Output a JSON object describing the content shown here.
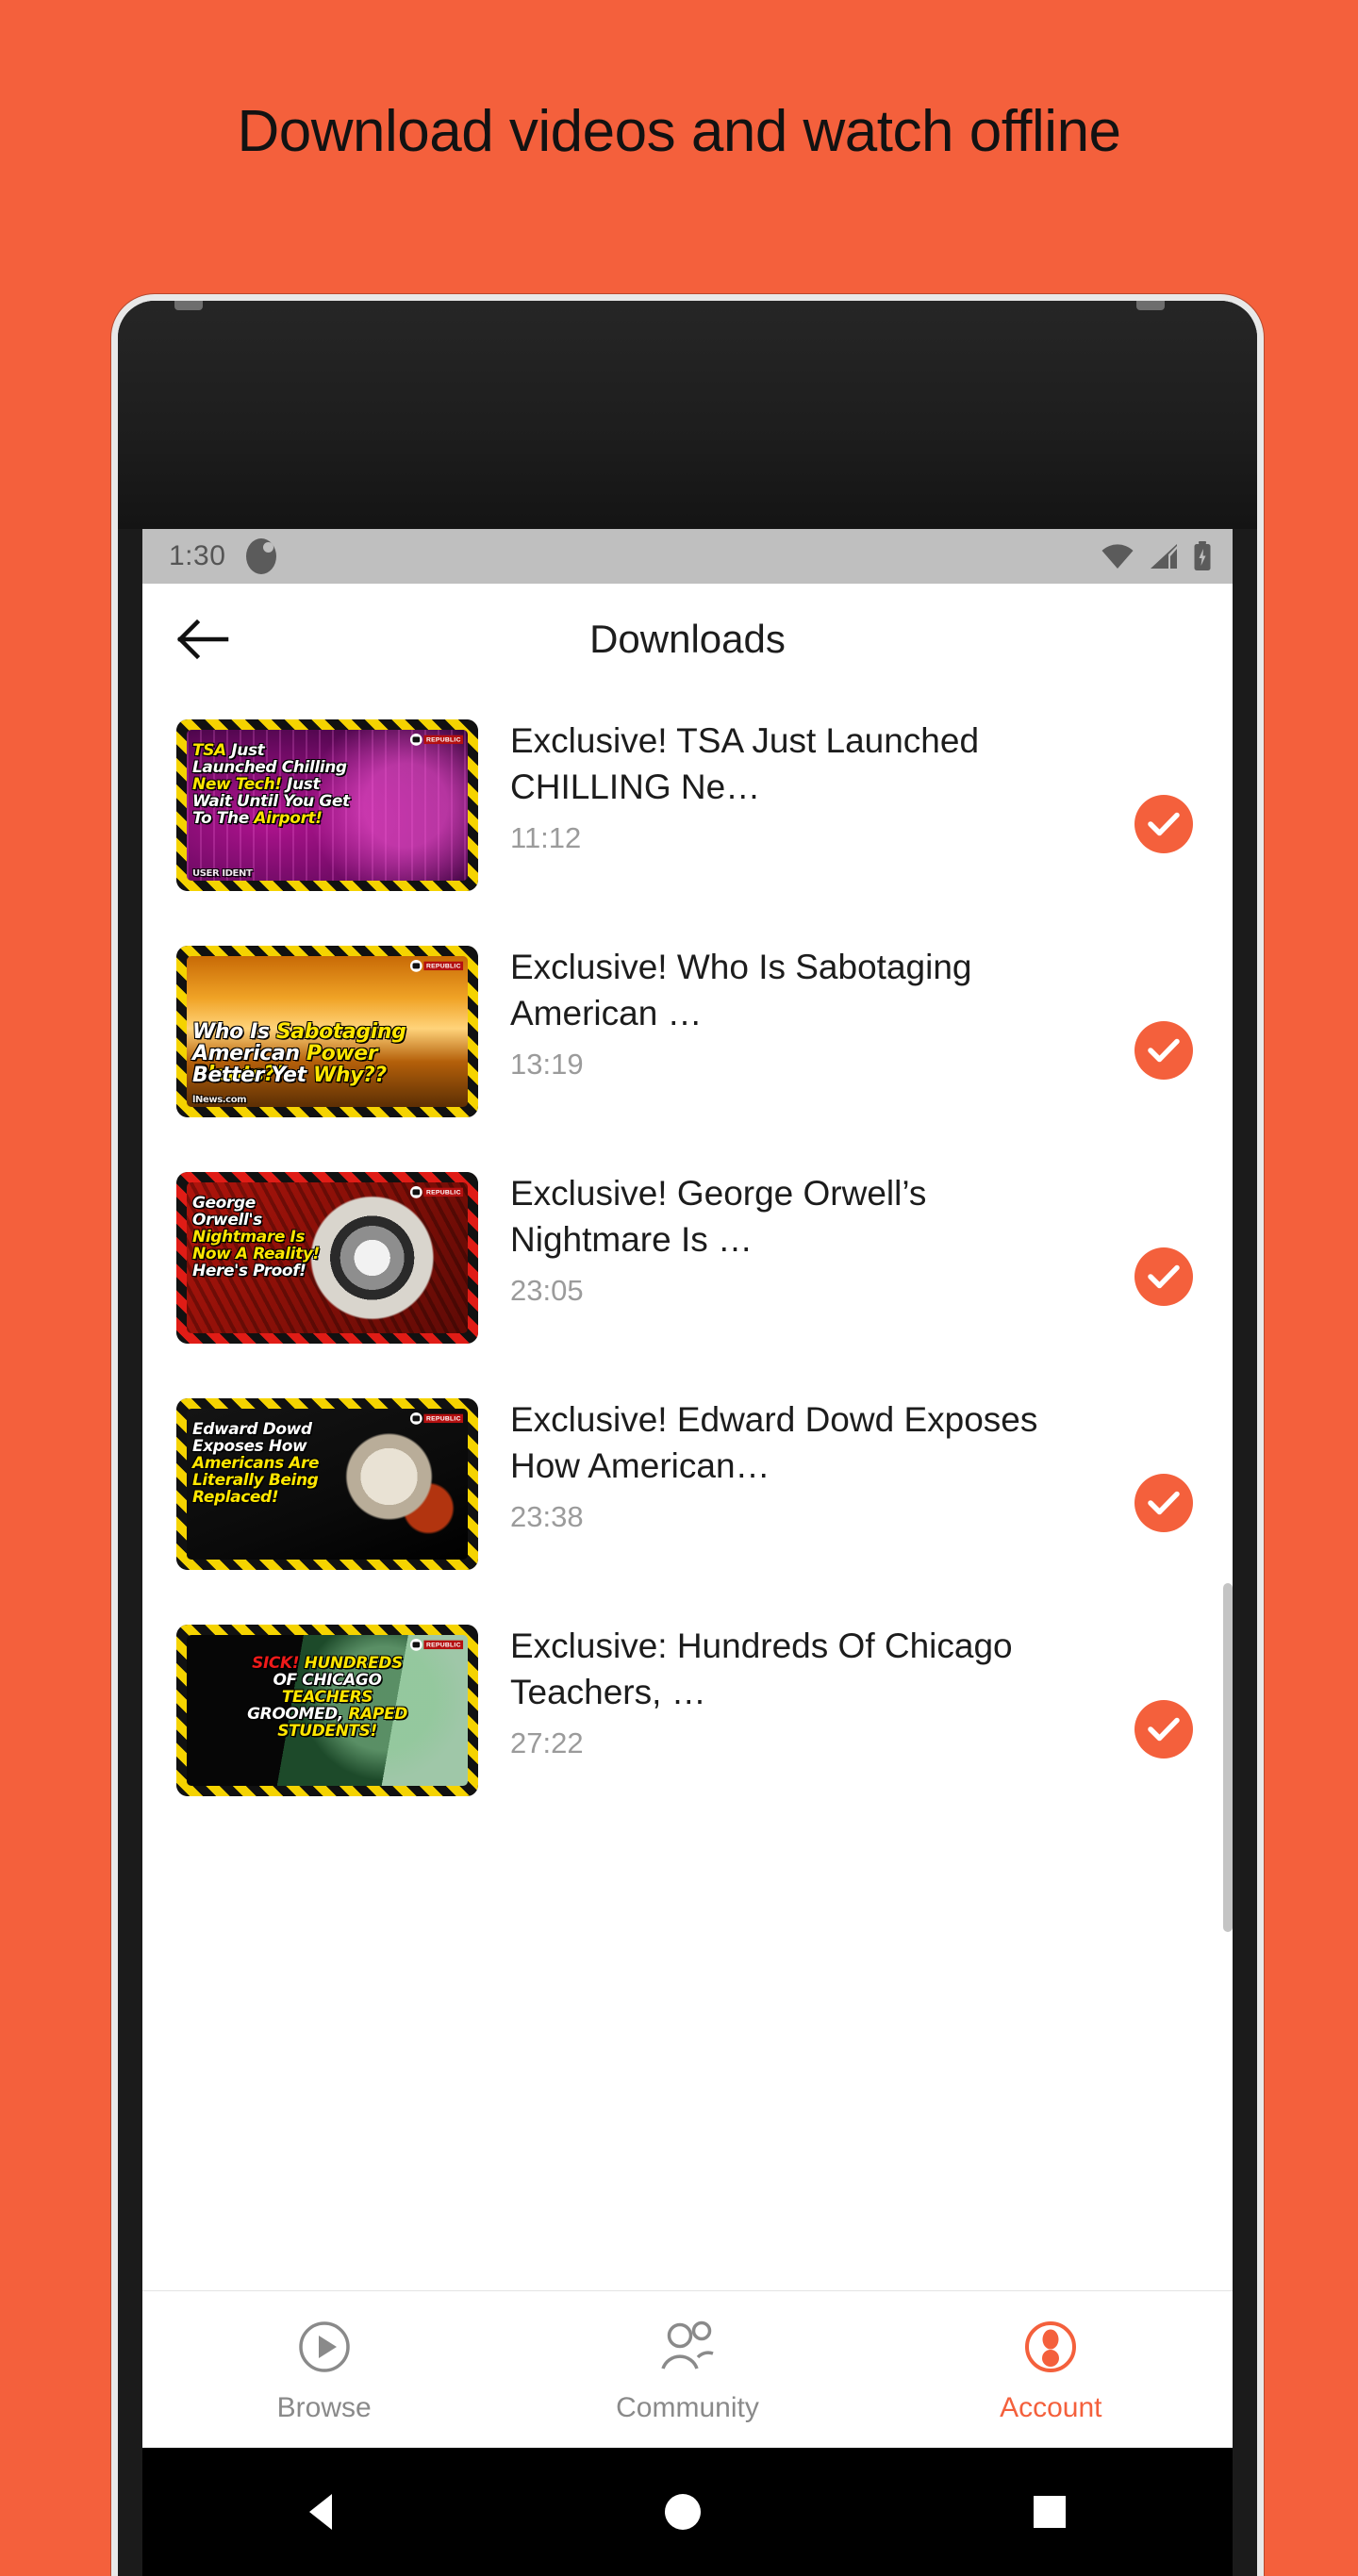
{
  "page": {
    "headline": "Download videos and watch offline",
    "background_color": "#F4603C",
    "accent_color": "#F4603C"
  },
  "statusbar": {
    "time": "1:30",
    "notification_icon": "app-notification-icon",
    "icons": [
      "wifi-icon",
      "cell-signal-icon",
      "battery-charging-icon"
    ]
  },
  "appbar": {
    "back_icon": "back-arrow-icon",
    "title": "Downloads"
  },
  "downloads": [
    {
      "title": "Exclusive! TSA Just Launched CHILLING Ne…",
      "duration": "11:12",
      "checked": true,
      "thumb": {
        "border": "yellow-hazard",
        "bg": "magenta-face-scan",
        "watermark": "REPUBLIC",
        "footer": "USER IDENT",
        "lines": [
          [
            {
              "t": "TSA ",
              "c": "y"
            },
            {
              "t": "Just",
              "c": "w"
            }
          ],
          [
            {
              "t": "Launched Chilling",
              "c": "w"
            }
          ],
          [
            {
              "t": "New Tech!",
              "c": "y"
            },
            {
              "t": " Just",
              "c": "w"
            }
          ],
          [
            {
              "t": "Wait Until You Get",
              "c": "w"
            }
          ],
          [
            {
              "t": "To The ",
              "c": "w"
            },
            {
              "t": "Airport!",
              "c": "y"
            }
          ]
        ]
      }
    },
    {
      "title": "Exclusive! Who Is Sabotaging American …",
      "duration": "13:19",
      "checked": true,
      "thumb": {
        "border": "yellow-hazard",
        "bg": "orange-power-plant",
        "watermark": "REPUBLIC",
        "footer": "lNews.com",
        "lines": [
          [
            {
              "t": "Who Is ",
              "c": "w"
            },
            {
              "t": "Sabotaging",
              "c": "y"
            }
          ],
          [
            {
              "t": "American ",
              "c": "w"
            },
            {
              "t": "Power Plants?!",
              "c": "y"
            }
          ],
          [
            {
              "t": "Better Yet ",
              "c": "w"
            },
            {
              "t": "Why??",
              "c": "y"
            }
          ]
        ]
      }
    },
    {
      "title": "Exclusive! George Orwell’s Nightmare Is …",
      "duration": "23:05",
      "checked": true,
      "thumb": {
        "border": "red-hazard",
        "bg": "red-surveillance-eye",
        "watermark": "REPUBLIC",
        "footer": "",
        "lines": [
          [
            {
              "t": "George",
              "c": "w"
            }
          ],
          [
            {
              "t": "Orwell's",
              "c": "w"
            }
          ],
          [
            {
              "t": "Nightmare Is",
              "c": "y"
            }
          ],
          [
            {
              "t": "Now A Reality!",
              "c": "y"
            }
          ],
          [
            {
              "t": "Here's Proof!",
              "c": "w"
            }
          ]
        ]
      }
    },
    {
      "title": "Exclusive! Edward Dowd Exposes How American…",
      "duration": "23:38",
      "checked": true,
      "thumb": {
        "border": "yellow-hazard",
        "bg": "skull-and-snake",
        "watermark": "REPUBLIC",
        "footer": "",
        "lines": [
          [
            {
              "t": "Edward Dowd",
              "c": "w"
            }
          ],
          [
            {
              "t": "Exposes How",
              "c": "w"
            }
          ],
          [
            {
              "t": "Americans Are",
              "c": "y"
            }
          ],
          [
            {
              "t": "Literally Being",
              "c": "y"
            }
          ],
          [
            {
              "t": "Replaced!",
              "c": "y"
            }
          ]
        ]
      }
    },
    {
      "title": "Exclusive: Hundreds Of Chicago Teachers, …",
      "duration": "27:22",
      "checked": true,
      "thumb": {
        "border": "yellow-hazard",
        "bg": "chicago-public-schools",
        "watermark": "REPUBLIC",
        "footer": "",
        "lines": [
          [
            {
              "t": "SICK! ",
              "c": "r"
            },
            {
              "t": "HUNDREDS",
              "c": "y"
            }
          ],
          [
            {
              "t": "OF CHICAGO",
              "c": "w"
            }
          ],
          [
            {
              "t": "TEACHERS",
              "c": "y"
            }
          ],
          [
            {
              "t": "GROOMED, ",
              "c": "w"
            },
            {
              "t": "RAPED",
              "c": "y"
            }
          ],
          [
            {
              "t": "STUDENTS!",
              "c": "y"
            }
          ]
        ]
      }
    }
  ],
  "bottomnav": {
    "items": [
      {
        "label": "Browse",
        "icon": "play-circle-icon",
        "active": false
      },
      {
        "label": "Community",
        "icon": "people-icon",
        "active": false
      },
      {
        "label": "Account",
        "icon": "account-circle-icon",
        "active": true
      }
    ]
  },
  "androidnav": {
    "back": "android-back-icon",
    "home": "android-home-icon",
    "recents": "android-recents-icon"
  }
}
